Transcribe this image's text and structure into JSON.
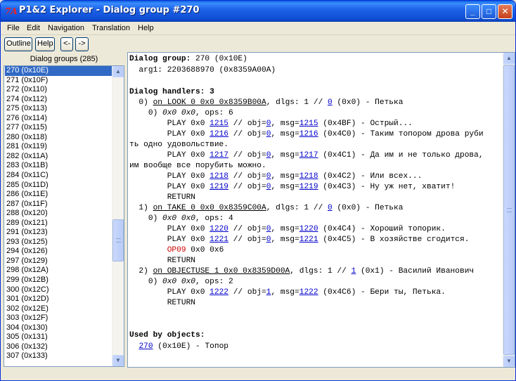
{
  "window": {
    "title": "P1&2 Explorer - Dialog group #270",
    "icon_label": "7A",
    "min_glyph": "_",
    "max_glyph": "□",
    "close_glyph": "✕"
  },
  "menu": [
    "File",
    "Edit",
    "Navigation",
    "Translation",
    "Help"
  ],
  "toolbar": {
    "outline": "Outline",
    "help": "Help",
    "back": "<-",
    "forward": "->"
  },
  "left_panel": {
    "header": "Dialog groups (285)",
    "items": [
      "270 (0x10E)",
      "271 (0x10F)",
      "272 (0x110)",
      "274 (0x112)",
      "275 (0x113)",
      "276 (0x114)",
      "277 (0x115)",
      "280 (0x118)",
      "281 (0x119)",
      "282 (0x11A)",
      "283 (0x11B)",
      "284 (0x11C)",
      "285 (0x11D)",
      "286 (0x11E)",
      "287 (0x11F)",
      "288 (0x120)",
      "289 (0x121)",
      "291 (0x123)",
      "293 (0x125)",
      "294 (0x126)",
      "297 (0x129)",
      "298 (0x12A)",
      "299 (0x12B)",
      "300 (0x12C)",
      "301 (0x12D)",
      "302 (0x12E)",
      "303 (0x12F)",
      "304 (0x130)",
      "305 (0x131)",
      "306 (0x132)",
      "307 (0x133)"
    ],
    "selected_index": 0
  },
  "scroll_glyphs": {
    "up": "▲",
    "down": "▼"
  },
  "detail": {
    "group_label": "Dialog group:",
    "group_value": " 270 (0x10E)",
    "arg_line": "  arg1: 2203688970 (0x8359A00A)",
    "handlers_label": "Dialog handlers: 3",
    "h0_prefix": "  0) ",
    "h0_link": "on LOOK 0 0x0 0x8359B00A",
    "h0_mid": ", dlgs: 1 // ",
    "h0_ref": "0",
    "h0_tail": " (0x0) - Петька",
    "h0_op_idx": "    0) ",
    "h0_op_name": "0x0 0x0",
    "h0_op_tail": ", ops: 6",
    "h0_lines": [
      {
        "a": "        PLAY 0x0 ",
        "m": "1215",
        "b": " // obj=",
        "o": "0",
        "c": ", msg=",
        "g": "1215",
        "d": " (0x4BF) - Острый..."
      },
      {
        "a": "        PLAY 0x0 ",
        "m": "1216",
        "b": " // obj=",
        "o": "0",
        "c": ", msg=",
        "g": "1216",
        "d": " (0x4C0) - Таким топором дрова руби"
      },
      {
        "a": "        PLAY 0x0 ",
        "m": "1217",
        "b": " // obj=",
        "o": "0",
        "c": ", msg=",
        "g": "1217",
        "d": " (0x4C1) - Да им и не только дрова,"
      },
      {
        "a": "        PLAY 0x0 ",
        "m": "1218",
        "b": " // obj=",
        "o": "0",
        "c": ", msg=",
        "g": "1218",
        "d": " (0x4C2) - Или всех..."
      },
      {
        "a": "        PLAY 0x0 ",
        "m": "1219",
        "b": " // obj=",
        "o": "0",
        "c": ", msg=",
        "g": "1219",
        "d": " (0x4C3) - Ну уж нет, хватит!"
      }
    ],
    "h0_wrap1": "ть одно удовольствие.",
    "h0_wrap2": "им вообще все порубить можно.",
    "return_text": "        RETURN",
    "h1_prefix": "  1) ",
    "h1_link": "on TAKE 0 0x0 0x8359C00A",
    "h1_mid": ", dlgs: 1 // ",
    "h1_ref": "0",
    "h1_tail": " (0x0) - Петька",
    "h1_op_idx": "    0) ",
    "h1_op_name": "0x0 0x0",
    "h1_op_tail": ", ops: 4",
    "h1_lines": [
      {
        "a": "        PLAY 0x0 ",
        "m": "1220",
        "b": " // obj=",
        "o": "0",
        "c": ", msg=",
        "g": "1220",
        "d": " (0x4C4) - Хороший топорик."
      },
      {
        "a": "        PLAY 0x0 ",
        "m": "1221",
        "b": " // obj=",
        "o": "0",
        "c": ", msg=",
        "g": "1221",
        "d": " (0x4C5) - В хозяйстве сгодится."
      }
    ],
    "op09_indent": "        ",
    "op09_name": "OP09",
    "op09_args": " 0x0 0x6",
    "h2_prefix": "  2) ",
    "h2_link": "on OBJECTUSE 1 0x0 0x8359D00A",
    "h2_mid": ", dlgs: 1 // ",
    "h2_ref": "1",
    "h2_tail": " (0x1) - Василий Иванович",
    "h2_op_idx": "    0) ",
    "h2_op_name": "0x0 0x0",
    "h2_op_tail": ", ops: 2",
    "h2_lines": [
      {
        "a": "        PLAY 0x0 ",
        "m": "1222",
        "b": " // obj=",
        "o": "1",
        "c": ", msg=",
        "g": "1222",
        "d": " (0x4C6) - Бери ты, Петька."
      }
    ],
    "used_label": "Used by objects:",
    "used_indent": "  ",
    "used_link": "270",
    "used_tail": " (0x10E) - Топор"
  },
  "colors": {
    "selection": "#316ac5",
    "link": "#0000cc",
    "op_red": "#cc0000",
    "titlebar": "#0f4fd6"
  }
}
